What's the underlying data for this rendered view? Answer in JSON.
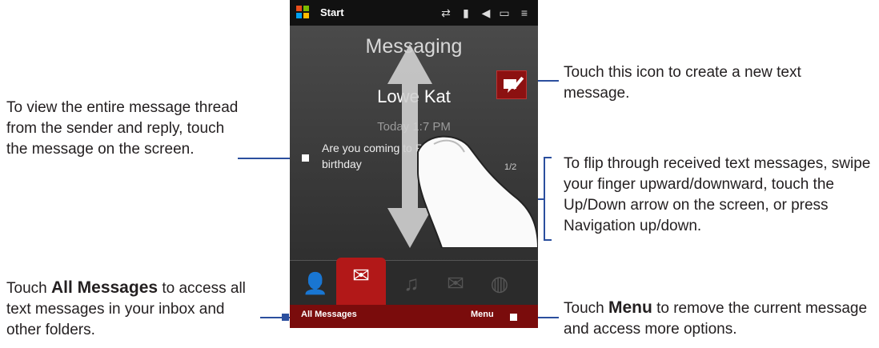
{
  "phone": {
    "status": {
      "start_label": "Start"
    },
    "screen_title": "Messaging",
    "sender": "Lowe Kat",
    "time": "Today 1:7 PM",
    "message_preview": "Are you coming to Regie's birthday",
    "counter": "1/2",
    "softkeys": {
      "left": "All Messages",
      "right": "Menu"
    },
    "tabs": [
      "contact-icon",
      "messaging-icon",
      "music-icon",
      "email-icon",
      "internet-icon"
    ]
  },
  "callouts": {
    "view_thread": "To view the entire message thread from the sender and reply, touch the message on the screen.",
    "new_message": "Touch this icon to create a new text message.",
    "flip": "To flip through received text messages, swipe your finger upward/downward, touch the Up/Down arrow on the screen, or press Navigation up/down.",
    "all_messages_pre": "Touch ",
    "all_messages_bold": "All Messages",
    "all_messages_post": " to access all text messages in your inbox and other folders.",
    "menu_pre": "Touch ",
    "menu_bold": "Menu",
    "menu_post": " to remove the current message and access more options."
  },
  "colors": {
    "accent": "#2b4f9e",
    "softkey_bar": "#7a0c0c",
    "active_tab": "#b21818"
  }
}
